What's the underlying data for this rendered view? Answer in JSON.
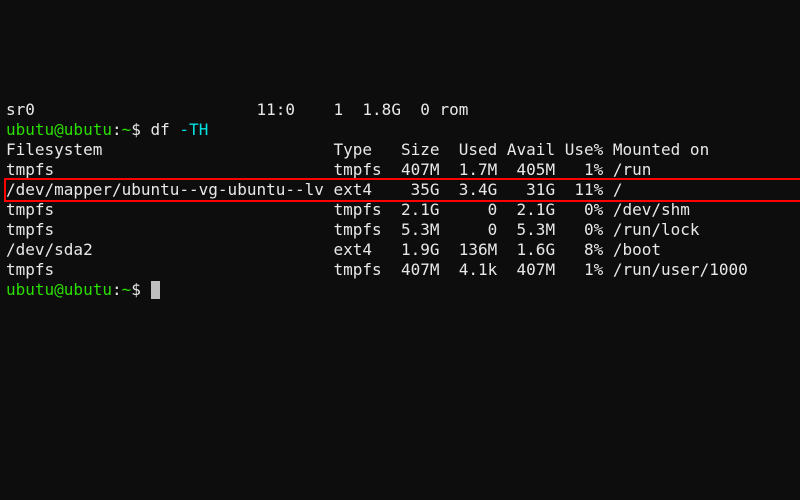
{
  "lines": {
    "l0": "sr0                       11:0    1  1.8G  0 rom",
    "prompt1_user": "ubutu@ubutu",
    "prompt1_sep": ":",
    "prompt1_path": "~",
    "prompt1_end": "$ ",
    "cmd1": "df ",
    "cmd1_flag": "-TH",
    "hdr": "Filesystem                        Type   Size  Used Avail Use% Mounted on",
    "r1": "tmpfs                             tmpfs  407M  1.7M  405M   1% /run",
    "hl": "/dev/mapper/ubuntu--vg-ubuntu--lv ext4    35G  3.4G   31G  11% /",
    "r2": "tmpfs                             tmpfs  2.1G     0  2.1G   0% /dev/shm",
    "r3": "tmpfs                             tmpfs  5.3M     0  5.3M   0% /run/lock",
    "r4": "/dev/sda2                         ext4   1.9G  136M  1.6G   8% /boot",
    "r5": "tmpfs                             tmpfs  407M  4.1k  407M   1% /run/user/1000",
    "prompt2_user": "ubutu@ubutu",
    "prompt2_sep": ":",
    "prompt2_path": "~",
    "prompt2_end": "$ "
  },
  "df_table": {
    "columns": [
      "Filesystem",
      "Type",
      "Size",
      "Used",
      "Avail",
      "Use%",
      "Mounted on"
    ],
    "rows": [
      {
        "fs": "tmpfs",
        "type": "tmpfs",
        "size": "407M",
        "used": "1.7M",
        "avail": "405M",
        "usep": "1%",
        "mount": "/run"
      },
      {
        "fs": "/dev/mapper/ubuntu--vg-ubuntu--lv",
        "type": "ext4",
        "size": "35G",
        "used": "3.4G",
        "avail": "31G",
        "usep": "11%",
        "mount": "/",
        "highlighted": true
      },
      {
        "fs": "tmpfs",
        "type": "tmpfs",
        "size": "2.1G",
        "used": "0",
        "avail": "2.1G",
        "usep": "0%",
        "mount": "/dev/shm"
      },
      {
        "fs": "tmpfs",
        "type": "tmpfs",
        "size": "5.3M",
        "used": "0",
        "avail": "5.3M",
        "usep": "0%",
        "mount": "/run/lock"
      },
      {
        "fs": "/dev/sda2",
        "type": "ext4",
        "size": "1.9G",
        "used": "136M",
        "avail": "1.6G",
        "usep": "8%",
        "mount": "/boot"
      },
      {
        "fs": "tmpfs",
        "type": "tmpfs",
        "size": "407M",
        "used": "4.1k",
        "avail": "407M",
        "usep": "1%",
        "mount": "/run/user/1000"
      }
    ]
  }
}
